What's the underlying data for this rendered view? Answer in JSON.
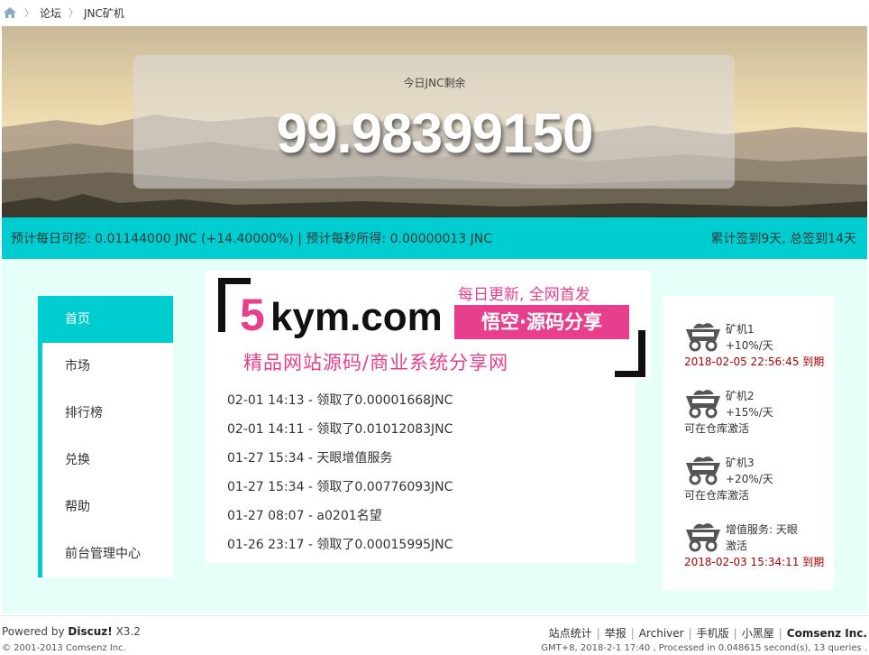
{
  "breadcrumb": {
    "home_icon": "home-icon",
    "forum": "论坛",
    "current": "JNC矿机"
  },
  "hero": {
    "label": "今日JNC剩余",
    "value": "99.98399150"
  },
  "stats": {
    "left": "预计每日可挖: 0.01144000 JNC (+14.40000%) | 预计每秒所得: 0.00000013 JNC",
    "right": "累计签到9天, 总签到14天"
  },
  "menu": {
    "items": [
      {
        "label": "首页",
        "active": true
      },
      {
        "label": "市场"
      },
      {
        "label": "排行榜"
      },
      {
        "label": "兑换"
      },
      {
        "label": "帮助"
      },
      {
        "label": "前台管理中心"
      }
    ]
  },
  "banner": {
    "five": "5",
    "kym": "kym.com",
    "daily": "每日更新, 全网首发",
    "box": "悟空·源码分享",
    "sub": "精品网站源码/商业系统分享网"
  },
  "log": [
    "02-01 14:13 - 领取了0.00001668JNC",
    "02-01 14:11 - 领取了0.01012083JNC",
    "01-27 15:34 - 天眼增值服务",
    "01-27 15:34 - 领取了0.00776093JNC",
    "01-27 08:07 - a0201名望",
    "01-26 23:17 - 领取了0.00015995JNC"
  ],
  "miners": [
    {
      "name": "矿机1",
      "rate": "+10%/天",
      "status": "2018-02-05 22:56:45 到期",
      "icon": "mine-cart-icon"
    },
    {
      "name": "矿机2",
      "rate": "+15%/天",
      "status": "可在仓库激活",
      "icon": "mine-cart-icon"
    },
    {
      "name": "矿机3",
      "rate": "+20%/天",
      "status": "可在仓库激活",
      "icon": "mine-cart-icon"
    },
    {
      "name": "增值服务: 天眼",
      "rate": "激活",
      "status": "2018-02-03 15:34:11 到期",
      "icon": "mine-cart-icon"
    }
  ],
  "footer": {
    "powered_prefix": "Powered by",
    "powered_brand": "Discuz!",
    "powered_version": "X3.2",
    "copyright": "© 2001-2013 Comsenz Inc.",
    "links": [
      "站点统计",
      "举报",
      "Archiver",
      "手机版",
      "小黑屋"
    ],
    "company": "Comsenz Inc.",
    "processed": "GMT+8, 2018-2-1 17:40 , Processed in 0.048615 second(s), 13 queries ."
  },
  "colors": {
    "accent": "#00cdd0",
    "content_bg": "#e6fff9",
    "pink": "#e83f8c",
    "expire": "#b30000"
  }
}
